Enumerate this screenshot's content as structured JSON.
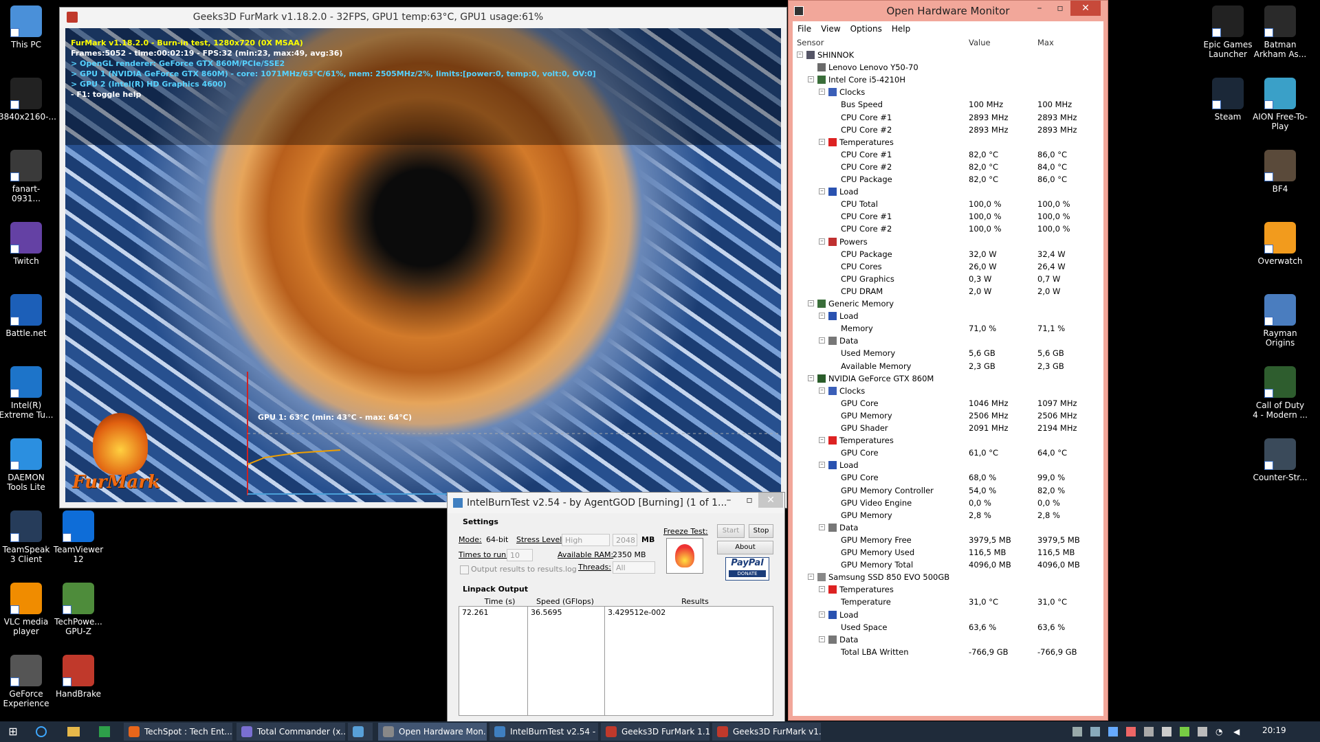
{
  "desktop": {
    "left_icons": [
      {
        "label": "This PC",
        "color": "#4a90d9"
      },
      {
        "label": "3840x2160-...",
        "color": "#222222"
      },
      {
        "label": "fanart-0931...",
        "color": "#3a3a3a"
      },
      {
        "label": "Twitch",
        "color": "#6441a4"
      },
      {
        "label": "Battle.net",
        "color": "#1c5fb8"
      },
      {
        "label": "Intel(R) Extreme Tu...",
        "color": "#1d74c9"
      },
      {
        "label": "DAEMON Tools Lite",
        "color": "#2b8fe0"
      },
      {
        "label": "TeamSpeak 3 Client",
        "color": "#263c5a"
      },
      {
        "label": "VLC media player",
        "color": "#f08c00"
      },
      {
        "label": "GeForce Experience",
        "color": "#555555"
      }
    ],
    "second_col_icons": [
      {
        "label": "TeamViewer 12",
        "color": "#0e6dd8"
      },
      {
        "label": "TechPowe... GPU-Z",
        "color": "#4e8c3b"
      },
      {
        "label": "HandBrake",
        "color": "#c0392b"
      }
    ],
    "right_icons": [
      {
        "label": "Epic Games Launcher",
        "color": "#222222"
      },
      {
        "label": "Batman Arkham As...",
        "color": "#2a2a2a"
      },
      {
        "label": "Steam",
        "color": "#1b2838"
      },
      {
        "label": "AION Free-To-Play",
        "color": "#3aa0c8"
      },
      {
        "label": "BF4",
        "color": "#5a4a3a"
      },
      {
        "label": "Overwatch",
        "color": "#f29b1d"
      },
      {
        "label": "Rayman Origins",
        "color": "#4a7dbf"
      },
      {
        "label": "Call of Duty 4 - Modern ...",
        "color": "#2e5d2e"
      },
      {
        "label": "Counter-Str...",
        "color": "#3a4a5a"
      }
    ]
  },
  "furmark": {
    "title": "Geeks3D FurMark v1.18.2.0 - 32FPS, GPU1 temp:63°C, GPU1 usage:61%",
    "hud": [
      {
        "text": "FurMark v1.18.2.0 - Burn-in test, 1280x720 (0X MSAA)",
        "cls": "hud-yellow"
      },
      {
        "text": "Frames:5052 - time:00:02:19 - FPS:32 (min:23, max:49, avg:36)",
        "cls": "hud-white"
      },
      {
        "text": "> OpenGL renderer: GeForce GTX 860M/PCIe/SSE2",
        "cls": "hud-cyan"
      },
      {
        "text": "> GPU 1 (NVIDIA GeForce GTX 860M) - core: 1071MHz/63°C/61%, mem: 2505MHz/2%, limits:[power:0, temp:0, volt:0, OV:0]",
        "cls": "hud-cyan"
      },
      {
        "text": "> GPU 2 (Intel(R) HD Graphics 4600)",
        "cls": "hud-cyan"
      },
      {
        "text": "- F1: toggle help",
        "cls": "hud-white"
      }
    ],
    "graph_label": "GPU 1: 63°C (min: 43°C - max: 64°C)",
    "logo_text": "FurMark"
  },
  "ibt": {
    "title": "IntelBurnTest v2.54 - by AgentGOD [Burning] (1 of 1...",
    "settings_label": "Settings",
    "mode_label": "Mode:",
    "mode_value": "64-bit",
    "stress_label": "Stress Level:",
    "stress_value": "High",
    "mb_value": "2048",
    "mb_unit": "MB",
    "times_label": "Times to run:",
    "times_value": "10",
    "ram_label": "Available RAM:",
    "ram_value": "2350 MB",
    "threads_label": "Threads:",
    "threads_value": "All",
    "output_log_label": "Output results to results.log",
    "freeze_label": "Freeze Test:",
    "start_label": "Start",
    "stop_label": "Stop",
    "about_label": "About",
    "paypal_label": "PayPal",
    "donate_label": "DONATE",
    "linpack_label": "Linpack Output",
    "columns": [
      "Time (s)",
      "Speed (GFlops)",
      "Results"
    ],
    "rows": [
      [
        "72.261",
        "36.5695",
        "3.429512e-002"
      ]
    ]
  },
  "ohm": {
    "title": "Open Hardware Monitor",
    "menu": [
      "File",
      "View",
      "Options",
      "Help"
    ],
    "headers": [
      "Sensor",
      "Value",
      "Max"
    ],
    "tree": [
      {
        "d": 0,
        "n": "SHINNOK",
        "icon": "pc",
        "exp": true
      },
      {
        "d": 1,
        "n": "Lenovo Lenovo Y50-70",
        "icon": "board"
      },
      {
        "d": 1,
        "n": "Intel Core i5-4210H",
        "icon": "chip",
        "exp": true
      },
      {
        "d": 2,
        "n": "Clocks",
        "icon": "clock",
        "exp": true
      },
      {
        "d": 3,
        "n": "Bus Speed",
        "v": "100 MHz",
        "m": "100 MHz"
      },
      {
        "d": 3,
        "n": "CPU Core #1",
        "v": "2893 MHz",
        "m": "2893 MHz"
      },
      {
        "d": 3,
        "n": "CPU Core #2",
        "v": "2893 MHz",
        "m": "2893 MHz"
      },
      {
        "d": 2,
        "n": "Temperatures",
        "icon": "temp",
        "exp": true
      },
      {
        "d": 3,
        "n": "CPU Core #1",
        "v": "82,0 °C",
        "m": "86,0 °C"
      },
      {
        "d": 3,
        "n": "CPU Core #2",
        "v": "82,0 °C",
        "m": "84,0 °C"
      },
      {
        "d": 3,
        "n": "CPU Package",
        "v": "82,0 °C",
        "m": "86,0 °C"
      },
      {
        "d": 2,
        "n": "Load",
        "icon": "load",
        "exp": true
      },
      {
        "d": 3,
        "n": "CPU Total",
        "v": "100,0 %",
        "m": "100,0 %"
      },
      {
        "d": 3,
        "n": "CPU Core #1",
        "v": "100,0 %",
        "m": "100,0 %"
      },
      {
        "d": 3,
        "n": "CPU Core #2",
        "v": "100,0 %",
        "m": "100,0 %"
      },
      {
        "d": 2,
        "n": "Powers",
        "icon": "power",
        "exp": true
      },
      {
        "d": 3,
        "n": "CPU Package",
        "v": "32,0 W",
        "m": "32,4 W"
      },
      {
        "d": 3,
        "n": "CPU Cores",
        "v": "26,0 W",
        "m": "26,4 W"
      },
      {
        "d": 3,
        "n": "CPU Graphics",
        "v": "0,3 W",
        "m": "0,7 W"
      },
      {
        "d": 3,
        "n": "CPU DRAM",
        "v": "2,0 W",
        "m": "2,0 W"
      },
      {
        "d": 1,
        "n": "Generic Memory",
        "icon": "ram",
        "exp": true
      },
      {
        "d": 2,
        "n": "Load",
        "icon": "load",
        "exp": true
      },
      {
        "d": 3,
        "n": "Memory",
        "v": "71,0 %",
        "m": "71,1 %"
      },
      {
        "d": 2,
        "n": "Data",
        "icon": "data",
        "exp": true
      },
      {
        "d": 3,
        "n": "Used Memory",
        "v": "5,6 GB",
        "m": "5,6 GB"
      },
      {
        "d": 3,
        "n": "Available Memory",
        "v": "2,3 GB",
        "m": "2,3 GB"
      },
      {
        "d": 1,
        "n": "NVIDIA GeForce GTX 860M",
        "icon": "gpu",
        "exp": true
      },
      {
        "d": 2,
        "n": "Clocks",
        "icon": "clock",
        "exp": true
      },
      {
        "d": 3,
        "n": "GPU Core",
        "v": "1046 MHz",
        "m": "1097 MHz"
      },
      {
        "d": 3,
        "n": "GPU Memory",
        "v": "2506 MHz",
        "m": "2506 MHz"
      },
      {
        "d": 3,
        "n": "GPU Shader",
        "v": "2091 MHz",
        "m": "2194 MHz"
      },
      {
        "d": 2,
        "n": "Temperatures",
        "icon": "temp",
        "exp": true
      },
      {
        "d": 3,
        "n": "GPU Core",
        "v": "61,0 °C",
        "m": "64,0 °C"
      },
      {
        "d": 2,
        "n": "Load",
        "icon": "load",
        "exp": true
      },
      {
        "d": 3,
        "n": "GPU Core",
        "v": "68,0 %",
        "m": "99,0 %"
      },
      {
        "d": 3,
        "n": "GPU Memory Controller",
        "v": "54,0 %",
        "m": "82,0 %"
      },
      {
        "d": 3,
        "n": "GPU Video Engine",
        "v": "0,0 %",
        "m": "0,0 %"
      },
      {
        "d": 3,
        "n": "GPU Memory",
        "v": "2,8 %",
        "m": "2,8 %"
      },
      {
        "d": 2,
        "n": "Data",
        "icon": "data",
        "exp": true
      },
      {
        "d": 3,
        "n": "GPU Memory Free",
        "v": "3979,5 MB",
        "m": "3979,5 MB"
      },
      {
        "d": 3,
        "n": "GPU Memory Used",
        "v": "116,5 MB",
        "m": "116,5 MB"
      },
      {
        "d": 3,
        "n": "GPU Memory Total",
        "v": "4096,0 MB",
        "m": "4096,0 MB"
      },
      {
        "d": 1,
        "n": "Samsung SSD 850 EVO 500GB",
        "icon": "disk",
        "exp": true
      },
      {
        "d": 2,
        "n": "Temperatures",
        "icon": "temp",
        "exp": true
      },
      {
        "d": 3,
        "n": "Temperature",
        "v": "31,0 °C",
        "m": "31,0 °C"
      },
      {
        "d": 2,
        "n": "Load",
        "icon": "load",
        "exp": true
      },
      {
        "d": 3,
        "n": "Used Space",
        "v": "63,6 %",
        "m": "63,6 %"
      },
      {
        "d": 2,
        "n": "Data",
        "icon": "data",
        "exp": true
      },
      {
        "d": 3,
        "n": "Total LBA Written",
        "v": "-766,9 GB",
        "m": "-766,9 GB"
      }
    ]
  },
  "taskbar": {
    "tasks": [
      {
        "label": "TechSpot : Tech Ent...",
        "color": "#e8661b"
      },
      {
        "label": "Total Commander (x...",
        "color": "#7a6fd1"
      },
      {
        "label": "",
        "color": "#58a0d8"
      },
      {
        "label": "Open Hardware Mon...",
        "color": "#888888",
        "active": true
      },
      {
        "label": "IntelBurnTest v2.54 - ...",
        "color": "#3f7fc0"
      },
      {
        "label": "Geeks3D FurMark 1.1...",
        "color": "#c0392b"
      },
      {
        "label": "Geeks3D FurMark v1....",
        "color": "#c0392b"
      }
    ],
    "clock": "20:19"
  },
  "colors": {
    "ohm_frame": "#f2a79a",
    "taskbar": "#1f2b3a",
    "hud_yellow": "#ffff00",
    "hud_cyan": "#56d2ff"
  }
}
